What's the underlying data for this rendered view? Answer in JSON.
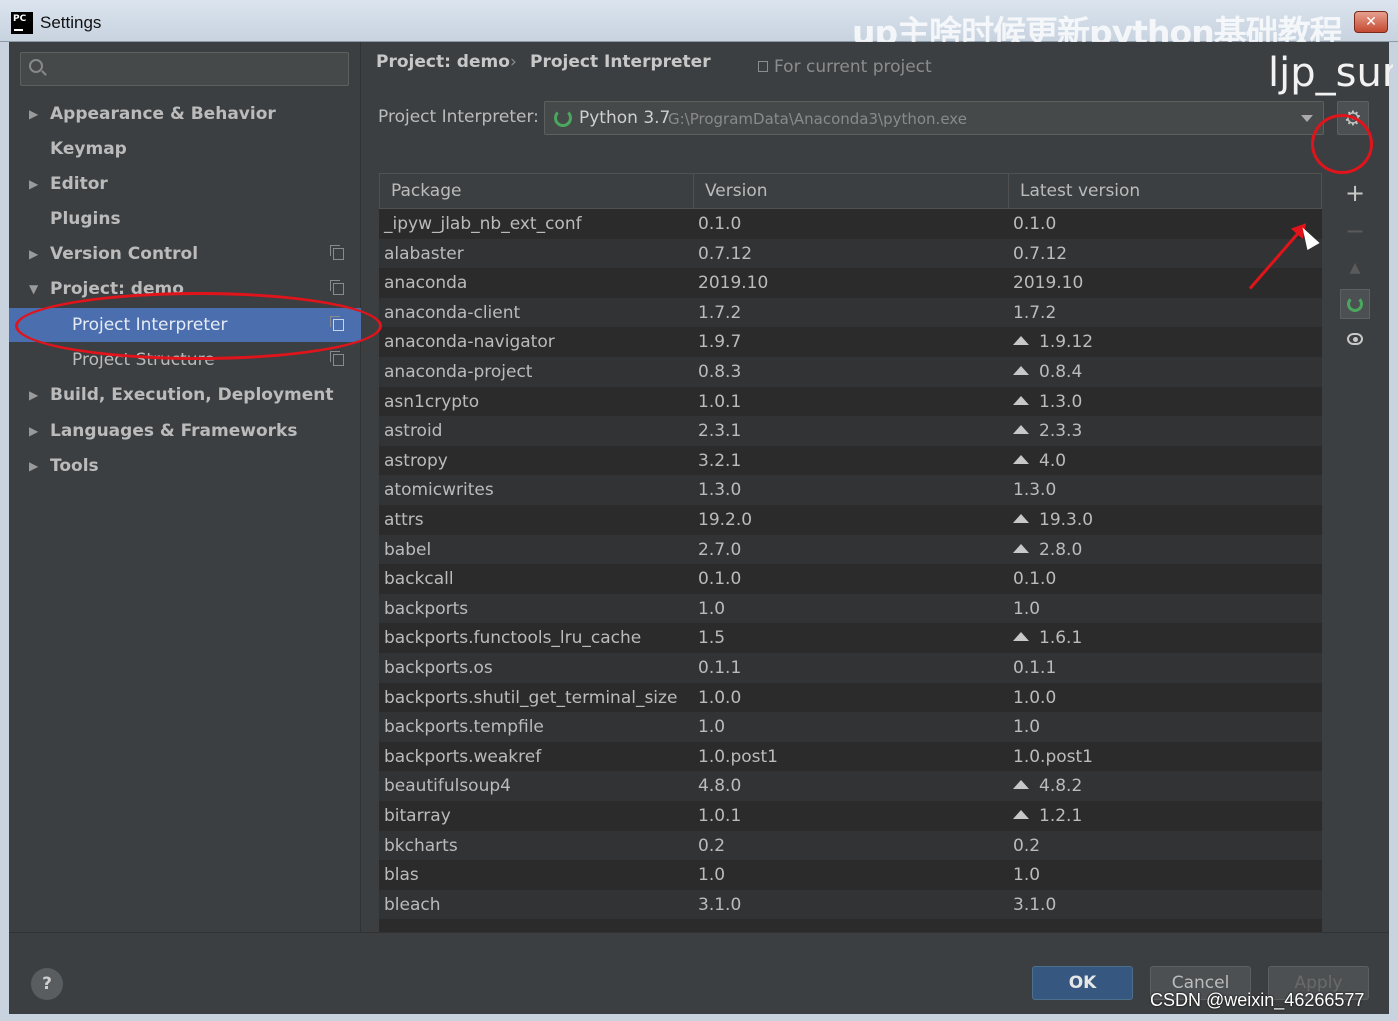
{
  "window": {
    "title": "Settings",
    "app_icon_text": "PC",
    "watermark_top": "up主啥时候更新python基础教程",
    "watermark_side": "ljp_sur",
    "footer_watermark": "CSDN @weixin_46266577"
  },
  "sidebar": {
    "search_placeholder": "",
    "items": [
      {
        "label": "Appearance & Behavior",
        "has_arrow": true
      },
      {
        "label": "Keymap"
      },
      {
        "label": "Editor",
        "has_arrow": true
      },
      {
        "label": "Plugins"
      },
      {
        "label": "Version Control",
        "has_arrow": true
      },
      {
        "label": "Project: demo",
        "expanded": true
      },
      {
        "label": "Project Interpreter",
        "selected": true
      },
      {
        "label": "Project Structure"
      },
      {
        "label": "Build, Execution, Deployment",
        "has_arrow": true
      },
      {
        "label": "Languages & Frameworks",
        "has_arrow": true
      },
      {
        "label": "Tools",
        "has_arrow": true
      }
    ]
  },
  "breadcrumb": {
    "part1": "Project: demo",
    "separator": "›",
    "part2": "Project Interpreter",
    "scope": "For current project"
  },
  "interpreter": {
    "label": "Project Interpreter:",
    "name": "Python 3.7",
    "path": "G:\\ProgramData\\Anaconda3\\python.exe"
  },
  "table": {
    "columns": [
      "Package",
      "Version",
      "Latest version"
    ],
    "rows": [
      [
        "_ipyw_jlab_nb_ext_conf",
        "0.1.0",
        "0.1.0",
        false
      ],
      [
        "alabaster",
        "0.7.12",
        "0.7.12",
        false
      ],
      [
        "anaconda",
        "2019.10",
        "2019.10",
        false
      ],
      [
        "anaconda-client",
        "1.7.2",
        "1.7.2",
        false
      ],
      [
        "anaconda-navigator",
        "1.9.7",
        "1.9.12",
        true
      ],
      [
        "anaconda-project",
        "0.8.3",
        "0.8.4",
        true
      ],
      [
        "asn1crypto",
        "1.0.1",
        "1.3.0",
        true
      ],
      [
        "astroid",
        "2.3.1",
        "2.3.3",
        true
      ],
      [
        "astropy",
        "3.2.1",
        "4.0",
        true
      ],
      [
        "atomicwrites",
        "1.3.0",
        "1.3.0",
        false
      ],
      [
        "attrs",
        "19.2.0",
        "19.3.0",
        true
      ],
      [
        "babel",
        "2.7.0",
        "2.8.0",
        true
      ],
      [
        "backcall",
        "0.1.0",
        "0.1.0",
        false
      ],
      [
        "backports",
        "1.0",
        "1.0",
        false
      ],
      [
        "backports.functools_lru_cache",
        "1.5",
        "1.6.1",
        true
      ],
      [
        "backports.os",
        "0.1.1",
        "0.1.1",
        false
      ],
      [
        "backports.shutil_get_terminal_size",
        "1.0.0",
        "1.0.0",
        false
      ],
      [
        "backports.tempfile",
        "1.0",
        "1.0",
        false
      ],
      [
        "backports.weakref",
        "1.0.post1",
        "1.0.post1",
        false
      ],
      [
        "beautifulsoup4",
        "4.8.0",
        "4.8.2",
        true
      ],
      [
        "bitarray",
        "1.0.1",
        "1.2.1",
        true
      ],
      [
        "bkcharts",
        "0.2",
        "0.2",
        false
      ],
      [
        "blas",
        "1.0",
        "1.0",
        false
      ],
      [
        "bleach",
        "3.1.0",
        "3.1.0",
        false
      ]
    ]
  },
  "toolbar": {
    "add": "+",
    "remove": "−",
    "upgrade": "▲"
  },
  "footer": {
    "help": "?",
    "ok": "OK",
    "cancel": "Cancel",
    "apply": "Apply"
  },
  "colors": {
    "annotation": "#e0141a",
    "selection": "#4b6eaf"
  }
}
